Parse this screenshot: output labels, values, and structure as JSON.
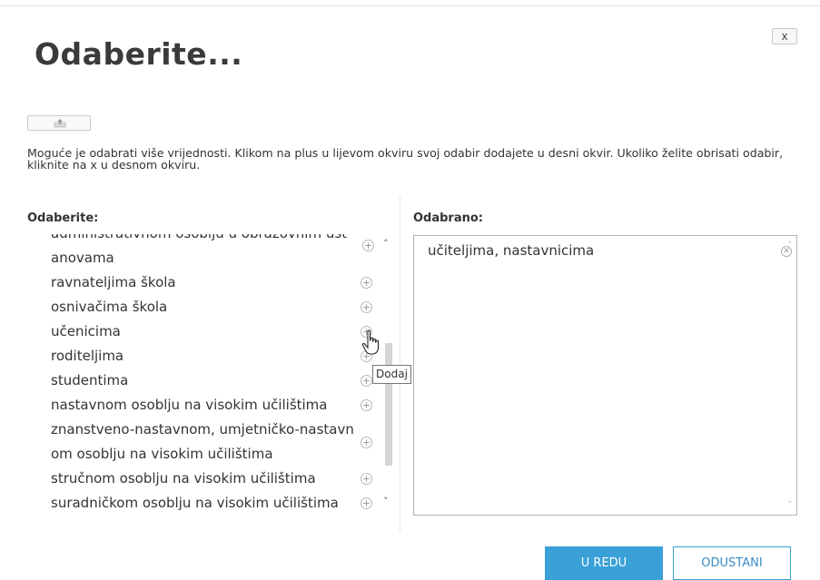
{
  "dialog": {
    "title": "Odaberite...",
    "close_label": "x",
    "instructions": "Moguće je odabrati više vrijednosti. Klikom na plus u lijevom okviru svoj odabir dodajete u desni okvir. Ukoliko želite obrisati odabir, kliknite na x u desnom okviru."
  },
  "left_panel": {
    "label": "Odaberite:",
    "items": [
      {
        "text": "administrativnom osoblju u obrazovnim ust"
      },
      {
        "text": "anovama"
      },
      {
        "text": "ravnateljima škola"
      },
      {
        "text": "osnivačima škola"
      },
      {
        "text": "učenicima"
      },
      {
        "text": "roditeljima"
      },
      {
        "text": "studentima"
      },
      {
        "text": "nastavnom osoblju na visokim učilištima"
      },
      {
        "text": "znanstveno-nastavnom, umjetničko-nastavn"
      },
      {
        "text": "om osoblju na visokim učilištima"
      },
      {
        "text": "stručnom osoblju na visokim učilištima"
      },
      {
        "text": "suradničkom osoblju na visokim učilištima"
      }
    ],
    "add_icon": "plus-circle-icon"
  },
  "right_panel": {
    "label": "Odabrano:",
    "selected": [
      {
        "text": "učiteljima, nastavnicima"
      }
    ],
    "remove_icon": "x-circle-icon"
  },
  "tooltip": {
    "text": "Dodaj"
  },
  "buttons": {
    "ok": "U REDU",
    "cancel": "ODUSTANI"
  },
  "colors": {
    "accent": "#3aa0d8",
    "text": "#333333",
    "border": "#b3b3b3"
  }
}
